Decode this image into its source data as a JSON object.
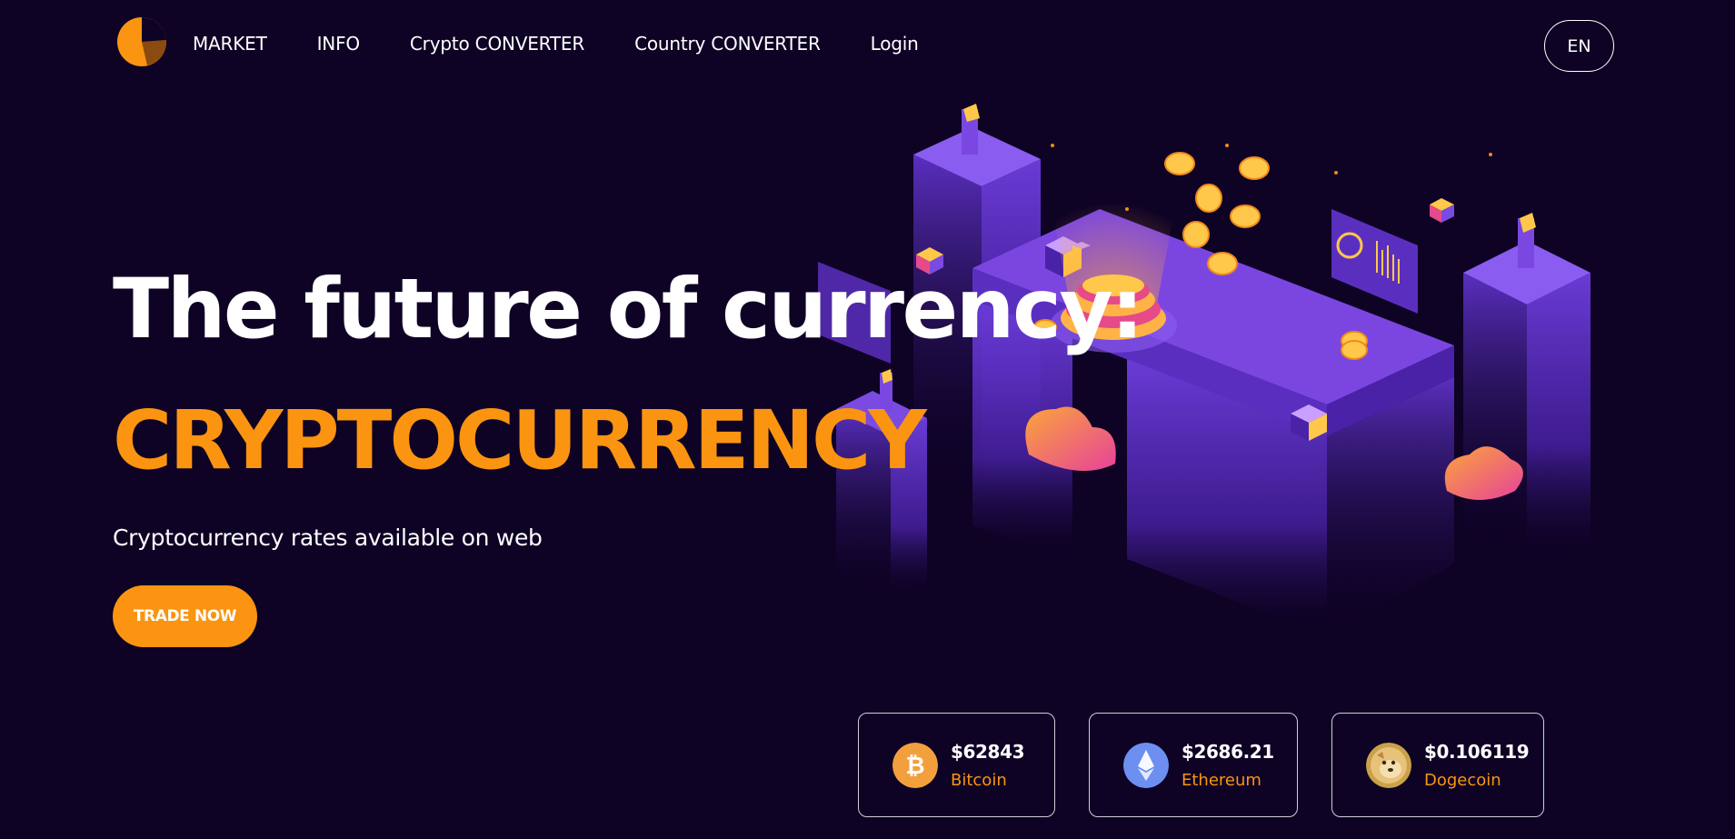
{
  "nav": {
    "links": [
      {
        "label": "MARKET"
      },
      {
        "label": "INFO"
      },
      {
        "label": "Crypto CONVERTER"
      },
      {
        "label": "Country CONVERTER"
      },
      {
        "label": "Login"
      }
    ],
    "language": "EN"
  },
  "hero": {
    "title": "The future of currency:",
    "highlight": "CRYPTOCURRENCY",
    "subtitle": "Cryptocurrency rates available on web",
    "cta_label": "TRADE NOW"
  },
  "coins": [
    {
      "price": "$62843",
      "name": "Bitcoin",
      "icon": "bitcoin-icon"
    },
    {
      "price": "$2686.21",
      "name": "Ethereum",
      "icon": "ethereum-icon"
    },
    {
      "price": "$0.106119",
      "name": "Dogecoin",
      "icon": "dogecoin-icon"
    }
  ],
  "colors": {
    "background": "#0e0225",
    "accent": "#fb9410",
    "illustration_purple": "#6a3bd6",
    "text": "#ffffff"
  }
}
